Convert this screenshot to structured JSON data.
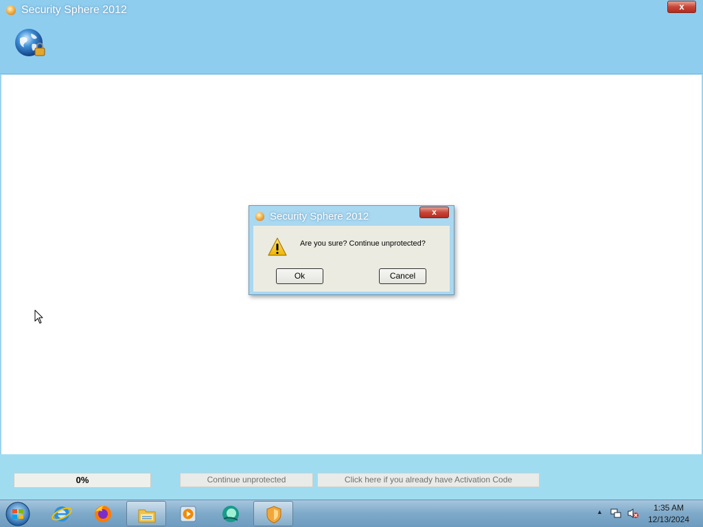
{
  "window": {
    "title": "Security Sphere 2012",
    "close_label": "x"
  },
  "bottom_bar": {
    "progress_text": "0%",
    "continue_label": "Continue unprotected",
    "activation_label": "Click here if you already have Activation Code"
  },
  "dialog": {
    "title": "Security Sphere 2012",
    "close_label": "x",
    "message": "Are you sure? Continue unprotected?",
    "ok_label": "Ok",
    "cancel_label": "Cancel"
  },
  "taskbar": {
    "items": [
      "start-orb-icon",
      "internet-explorer-icon",
      "firefox-icon",
      "file-explorer-icon",
      "media-player-icon",
      "app-icon",
      "security-sphere-icon"
    ],
    "tray_arrow": "▲",
    "clock_time": "1:35 AM",
    "clock_date": "12/13/2024"
  },
  "colors": {
    "title_bar": "#8fcdef",
    "bottom_bar": "#a0dcf0",
    "dialog_body": "#ecebe2",
    "close_red": "#c7463a"
  }
}
